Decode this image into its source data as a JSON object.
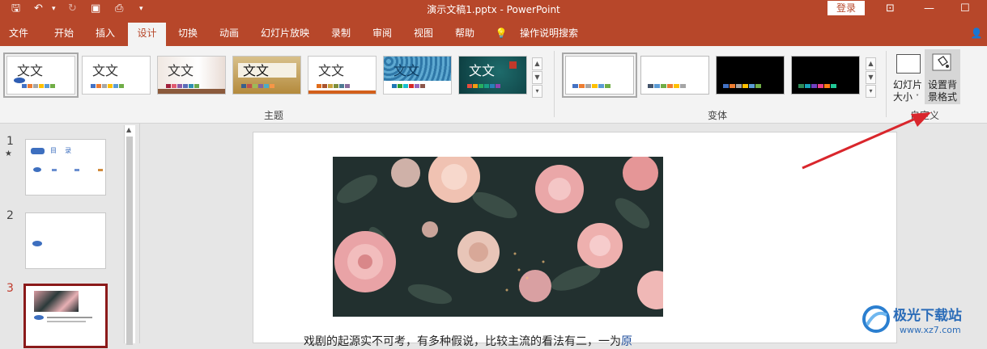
{
  "window": {
    "title": "演示文稿1.pptx  -  PowerPoint",
    "login": "登录"
  },
  "tabs": [
    "文件",
    "开始",
    "插入",
    "设计",
    "切换",
    "动画",
    "幻灯片放映",
    "录制",
    "审阅",
    "视图",
    "帮助",
    "操作说明搜索"
  ],
  "active_tab": "设计",
  "ribbon": {
    "theme_thumb_text": "文文",
    "themes_group": "主题",
    "variants_group": "变体",
    "slide_size_label_line1": "幻灯片",
    "slide_size_label_line2": "大小",
    "format_bg_label_line1": "设置背",
    "format_bg_label_line2": "景格式",
    "customize_group": "自定义"
  },
  "slides_pane": {
    "slides": [
      {
        "number": "1",
        "mark": "★",
        "title_text": "目    录"
      },
      {
        "number": "2",
        "mark": ""
      },
      {
        "number": "3",
        "mark": ""
      }
    ]
  },
  "slide": {
    "body_text": "戏剧的起源实不可考，有多种假说，比较主流的看法有二，一为",
    "link_text": "原"
  },
  "watermark": {
    "name": "极光下载站",
    "url": "www.xz7.com"
  },
  "colors": {
    "accent": "#b7472a",
    "arrow": "#d9262c",
    "selected_slide": "#8b1a1a"
  }
}
